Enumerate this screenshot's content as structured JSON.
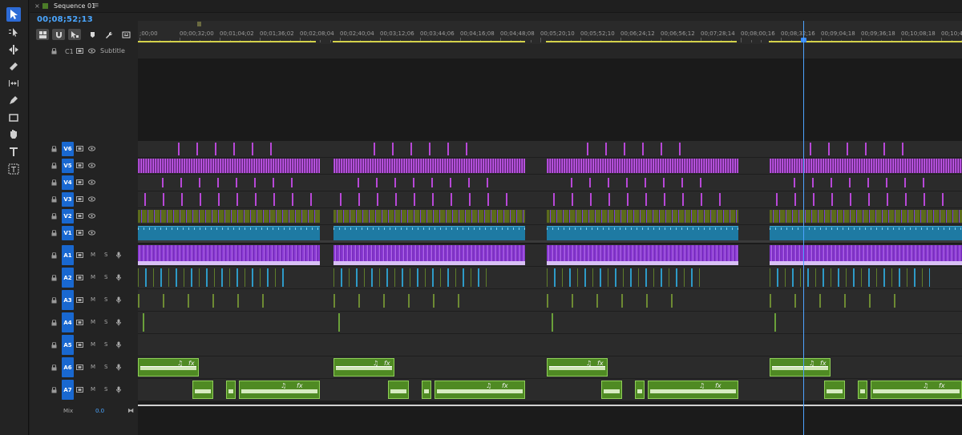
{
  "tab": {
    "close": "×",
    "title": "Sequence 01",
    "menu": "≡",
    "swatch_color": "#4b7c28"
  },
  "timecode": "00;08;52;13",
  "tools": [
    {
      "name": "selection-tool-icon",
      "active": true
    },
    {
      "name": "track-select-tool-icon",
      "active": false
    },
    {
      "name": "ripple-edit-tool-icon",
      "active": false
    },
    {
      "name": "razor-tool-icon",
      "active": false
    },
    {
      "name": "slip-tool-icon",
      "active": false
    },
    {
      "name": "pen-tool-icon",
      "active": false
    },
    {
      "name": "rectangle-tool-icon",
      "active": false
    },
    {
      "name": "hand-tool-icon",
      "active": false
    },
    {
      "name": "type-tool-icon",
      "active": false
    },
    {
      "name": "caption-tool-icon",
      "active": false
    }
  ],
  "timeline_buttons": [
    "insert-nest-icon",
    "snap-magnet-icon",
    "linked-selection-icon",
    "add-marker-icon",
    "timeline-settings-wrench-icon",
    "captions-icon"
  ],
  "ruler": {
    "labels": [
      ";00;00",
      "00;00;32;00",
      "00;01;04;02",
      "00;01;36;02",
      "00;02;08;04",
      "00;02;40;04",
      "00;03;12;06",
      "00;03;44;06",
      "00;04;16;08",
      "00;04;48;08",
      "00;05;20;10",
      "00;05;52;10",
      "00;06;24;12",
      "00;06;56;12",
      "00;07;28;14",
      "00;08;00;16",
      "00;08;32;16",
      "00;09;04;18",
      "00;09;36;18",
      "00;10;08;18",
      "00;10;40;18"
    ]
  },
  "subtitle_track": {
    "label": "C1",
    "name": "Subtitle"
  },
  "video_tracks": [
    "V6",
    "V5",
    "V4",
    "V3",
    "V2",
    "V1"
  ],
  "audio_tracks": [
    "A1",
    "A2",
    "A3",
    "A4",
    "A5",
    "A6",
    "A7"
  ],
  "audio_buttons": {
    "mute": "M",
    "solo": "S"
  },
  "mix": {
    "label": "Mix",
    "value": "0.0",
    "end_icon": "⧓"
  },
  "clip_glyphs": {
    "music": "♫",
    "fx": "fx"
  },
  "colors": {
    "accent": "#1968d0",
    "timecode": "#4aa6ff",
    "v1_clip": "#1e7aa3",
    "a1_clip": "#8b3ad4",
    "v5_clip": "#c45ee8",
    "audio_clip": "#4f8a23",
    "work_area": "#d4d24a"
  }
}
